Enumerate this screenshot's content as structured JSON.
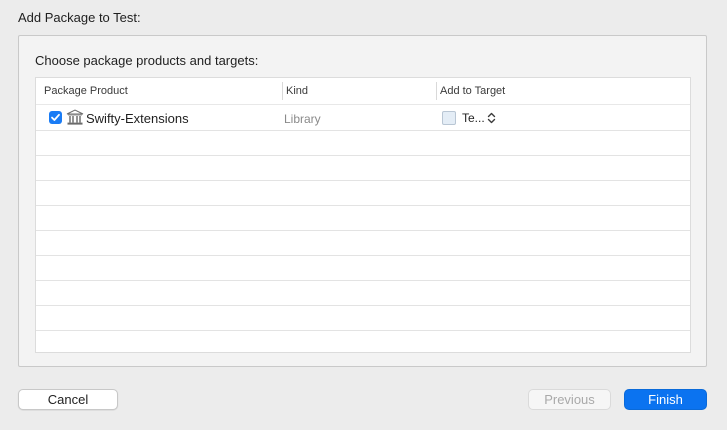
{
  "dialog": {
    "title": "Add Package to Test:"
  },
  "panel": {
    "heading": "Choose package products and targets:"
  },
  "table": {
    "columns": [
      "Package Product",
      "Kind",
      "Add to Target"
    ],
    "rows": [
      {
        "checked": true,
        "icon": "library-building-icon",
        "product": "Swifty-Extensions",
        "kind": "Library",
        "target": "Te...",
        "target_icon": "target-icon"
      }
    ],
    "empty_row_count": 8
  },
  "buttons": {
    "cancel": "Cancel",
    "previous": "Previous",
    "finish": "Finish"
  },
  "colors": {
    "accent": "#0b73f0",
    "window_background": "#ececec",
    "disabled_text": "#a9a9a9"
  }
}
